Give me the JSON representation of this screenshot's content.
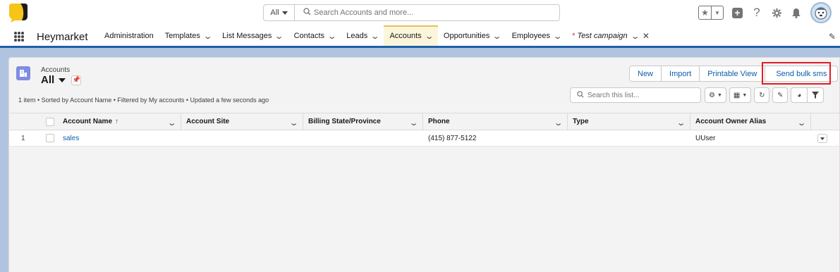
{
  "header": {
    "search_scope": "All",
    "search_placeholder": "Search Accounts and more...",
    "icons": [
      "favorites-star-icon",
      "favorites-dropdown-icon",
      "global-actions-plus-icon",
      "help-icon",
      "setup-gear-icon",
      "notifications-bell-icon",
      "user-avatar"
    ]
  },
  "nav": {
    "app_name": "Heymarket",
    "tabs": [
      {
        "label": "Administration",
        "has_menu": false,
        "active": false
      },
      {
        "label": "Templates",
        "has_menu": true,
        "active": false
      },
      {
        "label": "List Messages",
        "has_menu": true,
        "active": false
      },
      {
        "label": "Contacts",
        "has_menu": true,
        "active": false
      },
      {
        "label": "Leads",
        "has_menu": true,
        "active": false
      },
      {
        "label": "Accounts",
        "has_menu": true,
        "active": true
      },
      {
        "label": "Opportunities",
        "has_menu": true,
        "active": false
      },
      {
        "label": "Employees",
        "has_menu": true,
        "active": false
      }
    ],
    "temp_tab": {
      "prefix": "*",
      "label": "Test campaign"
    }
  },
  "list_view": {
    "object_label": "Accounts",
    "view_name": "All",
    "status": "1 item • Sorted by Account Name • Filtered by My accounts • Updated a few seconds ago",
    "buttons": {
      "new": "New",
      "import": "Import",
      "printable_view": "Printable View",
      "send_bulk_sms": "Send bulk sms"
    },
    "search_placeholder": "Search this list...",
    "columns": [
      "Account Name",
      "Account Site",
      "Billing State/Province",
      "Phone",
      "Type",
      "Account Owner Alias"
    ],
    "sorted_column": "Account Name",
    "rows": [
      {
        "num": "1",
        "account_name": "sales",
        "account_site": "",
        "billing_state": "",
        "phone": "(415) 877-5122",
        "type": "",
        "owner_alias": "UUser"
      }
    ]
  },
  "colors": {
    "brand_blue": "#0b5cab",
    "active_tab_bg": "#fbf5dc",
    "active_tab_accent": "#e4c35c",
    "highlight_red": "#e31b23",
    "object_icon": "#7f8de1",
    "logo_yellow": "#f5c518"
  }
}
